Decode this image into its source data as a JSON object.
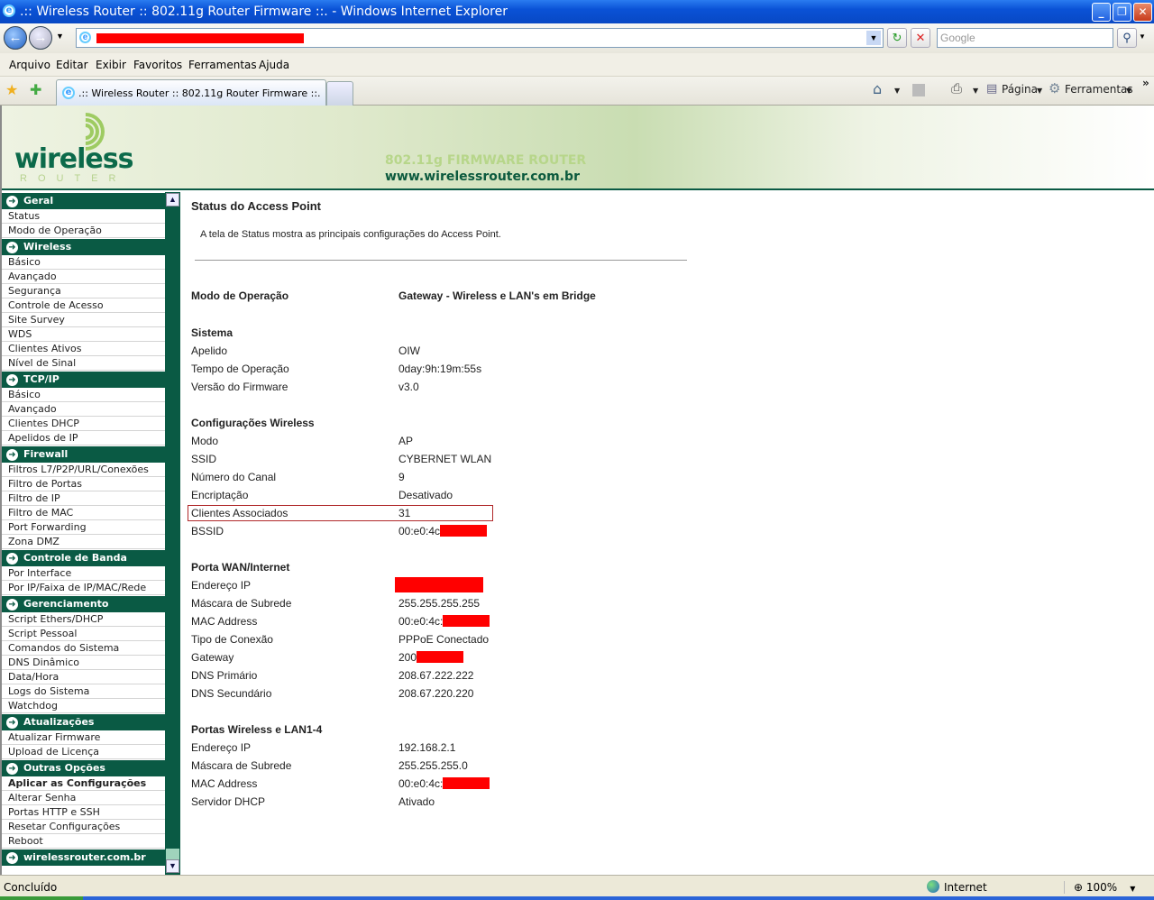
{
  "window": {
    "title": ".:: Wireless Router :: 802.11g Router Firmware ::. - Windows Internet Explorer",
    "minimize": "_",
    "restore": "❐",
    "close": "✕"
  },
  "toolbar": {
    "search_placeholder": "Google",
    "refresh": "↻",
    "stop": "✕"
  },
  "menu": [
    "Arquivo",
    "Editar",
    "Exibir",
    "Favoritos",
    "Ferramentas",
    "Ajuda"
  ],
  "tab": {
    "label": ".:: Wireless Router :: 802.11g Router Firmware ::."
  },
  "commands": {
    "pagina": "Página",
    "ferramentas": "Ferramentas",
    "more": "»"
  },
  "banner": {
    "logo": "wireless",
    "logo_sub": "ROUTER",
    "tagline": "802.11g FIRMWARE ROUTER",
    "url": "www.wirelessrouter.com.br"
  },
  "sidebar": [
    {
      "header": "Geral",
      "items": [
        "Status",
        "Modo de Operação"
      ]
    },
    {
      "header": "Wireless",
      "items": [
        "Básico",
        "Avançado",
        "Segurança",
        "Controle de Acesso",
        "Site Survey",
        "WDS",
        "Clientes Ativos",
        "Nível de Sinal"
      ]
    },
    {
      "header": "TCP/IP",
      "items": [
        "Básico",
        "Avançado",
        "Clientes DHCP",
        "Apelidos de IP"
      ]
    },
    {
      "header": "Firewall",
      "items": [
        "Filtros L7/P2P/URL/Conexões",
        "Filtro de Portas",
        "Filtro de IP",
        "Filtro de MAC",
        "Port Forwarding",
        "Zona DMZ"
      ]
    },
    {
      "header": "Controle de Banda",
      "items": [
        "Por Interface",
        "Por IP/Faixa de IP/MAC/Rede"
      ]
    },
    {
      "header": "Gerenciamento",
      "items": [
        "Script Ethers/DHCP",
        "Script Pessoal",
        "Comandos do Sistema",
        "DNS Dinâmico",
        "Data/Hora",
        "Logs do Sistema",
        "Watchdog"
      ]
    },
    {
      "header": "Atualizações",
      "items": [
        "Atualizar Firmware",
        "Upload de Licença"
      ]
    },
    {
      "header": "Outras Opções",
      "items": [
        "Aplicar as Configurações",
        "Alterar Senha",
        "Portas HTTP e SSH",
        "Resetar Configurações",
        "Reboot"
      ]
    },
    {
      "header": "wirelessrouter.com.br",
      "items": []
    }
  ],
  "main": {
    "title": "Status do Access Point",
    "description": "A tela de Status mostra as principais configurações do Access Point.",
    "mode": {
      "label": "Modo de Operação",
      "value": "Gateway - Wireless e LAN's em Bridge"
    },
    "sections": [
      {
        "title": "Sistema",
        "rows": [
          {
            "label": "Apelido",
            "value": "OIW"
          },
          {
            "label": "Tempo de Operação",
            "value": "0day:9h:19m:55s"
          },
          {
            "label": "Versão do Firmware",
            "value": "v3.0"
          }
        ]
      },
      {
        "title": "Configurações Wireless",
        "rows": [
          {
            "label": "Modo",
            "value": "AP"
          },
          {
            "label": "SSID",
            "value": "CYBERNET WLAN"
          },
          {
            "label": "Número do Canal",
            "value": "9"
          },
          {
            "label": "Encriptação",
            "value": "Desativado"
          },
          {
            "label": "Clientes Associados",
            "value": "31",
            "highlight": true
          },
          {
            "label": "BSSID",
            "value": "00:e0:4c",
            "redacted": true
          }
        ]
      },
      {
        "title": "Porta WAN/Internet",
        "rows": [
          {
            "label": "Endereço IP",
            "value": "",
            "redacted": true
          },
          {
            "label": "Máscara de Subrede",
            "value": "255.255.255.255"
          },
          {
            "label": "MAC Address",
            "value": "00:e0:4c:",
            "redacted": true
          },
          {
            "label": "Tipo de Conexão",
            "value": "PPPoE Conectado"
          },
          {
            "label": "Gateway",
            "value": "200",
            "redacted": true
          },
          {
            "label": "DNS Primário",
            "value": "208.67.222.222"
          },
          {
            "label": "DNS Secundário",
            "value": "208.67.220.220"
          }
        ]
      },
      {
        "title": "Portas Wireless e LAN1-4",
        "rows": [
          {
            "label": "Endereço IP",
            "value": "192.168.2.1"
          },
          {
            "label": "Máscara de Subrede",
            "value": "255.255.255.0"
          },
          {
            "label": "MAC Address",
            "value": "00:e0:4c:",
            "redacted": true
          },
          {
            "label": "Servidor DHCP",
            "value": "Ativado"
          }
        ]
      }
    ]
  },
  "statusbar": {
    "status": "Concluído",
    "zone": "Internet",
    "zoom": "100%"
  }
}
